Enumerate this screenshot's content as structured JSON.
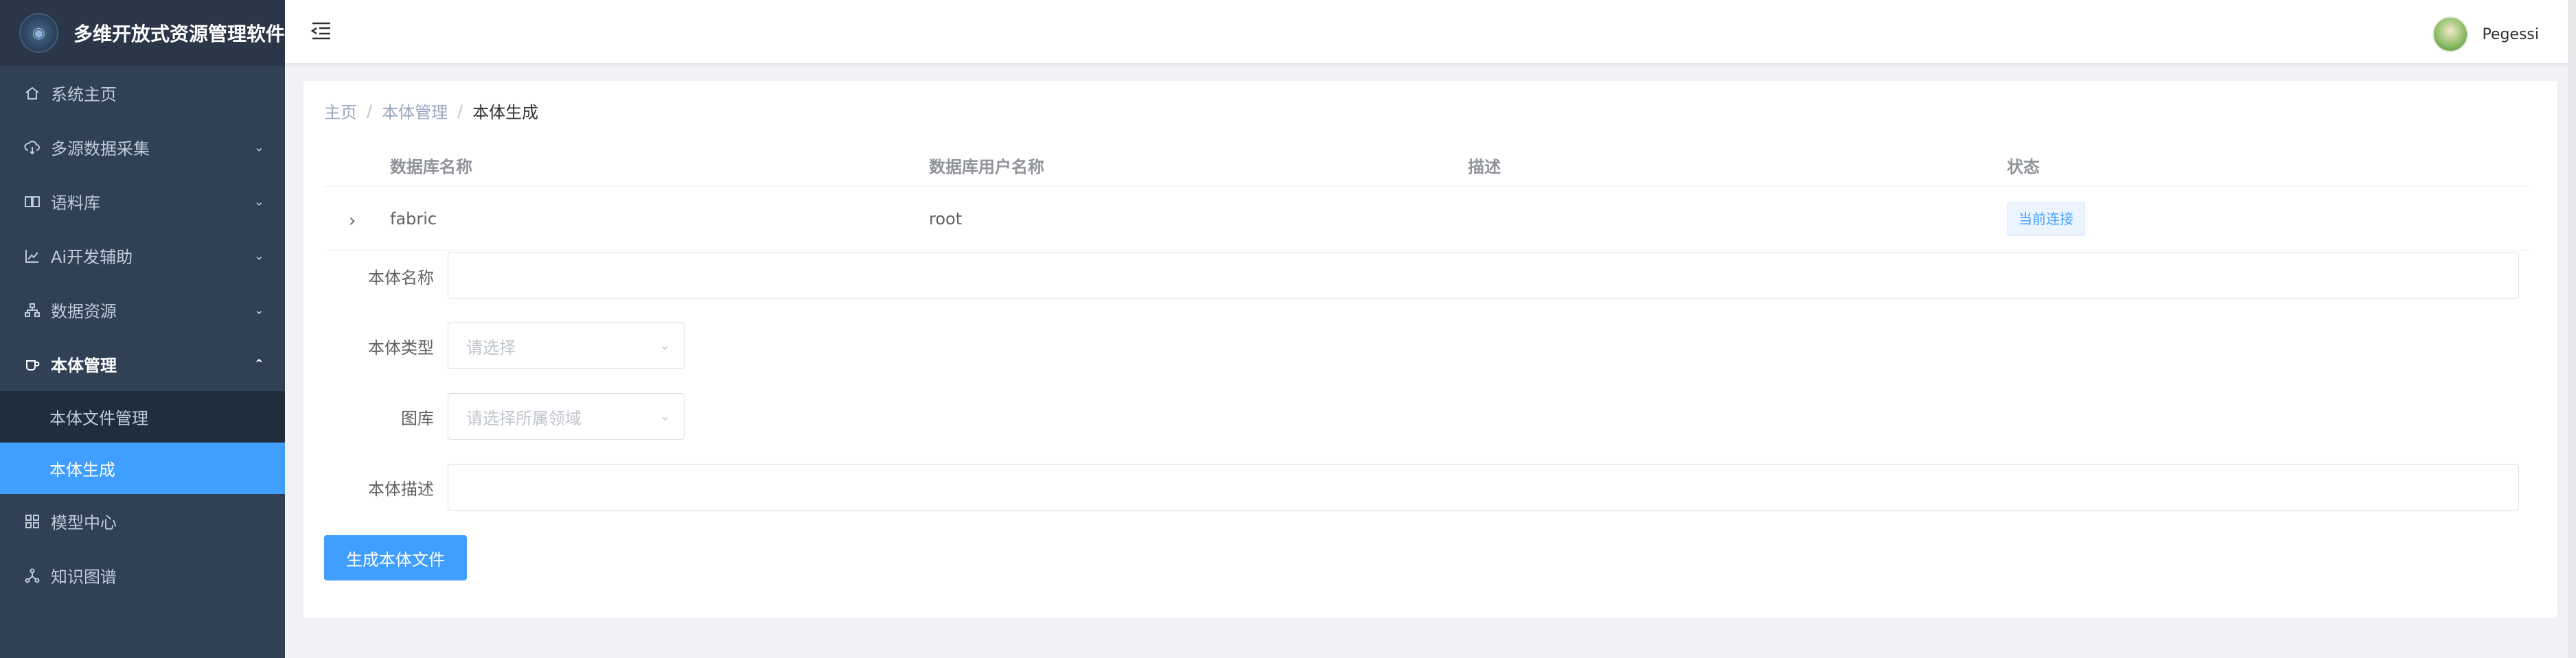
{
  "app": {
    "title": "多维开放式资源管理软件"
  },
  "sidebar": {
    "items": [
      {
        "label": "系统主页",
        "icon": "home-icon"
      },
      {
        "label": "多源数据采集",
        "icon": "cloud-download-icon"
      },
      {
        "label": "语料库",
        "icon": "book-icon"
      },
      {
        "label": "Ai开发辅助",
        "icon": "chart-line-icon"
      },
      {
        "label": "数据资源",
        "icon": "sitemap-icon"
      },
      {
        "label": "本体管理",
        "icon": "cup-icon"
      },
      {
        "label": "模型中心",
        "icon": "grid-icon"
      },
      {
        "label": "知识图谱",
        "icon": "share-icon"
      }
    ],
    "submenu": [
      {
        "label": "本体文件管理"
      },
      {
        "label": "本体生成"
      }
    ]
  },
  "navbar": {
    "username": "Pegessi"
  },
  "breadcrumb": {
    "items": [
      "主页",
      "本体管理",
      "本体生成"
    ],
    "separator": "/"
  },
  "table": {
    "headers": [
      "数据库名称",
      "数据库用户名称",
      "描述",
      "状态"
    ],
    "rows": [
      {
        "name": "fabric",
        "user": "root",
        "desc": "",
        "status": "当前连接"
      }
    ]
  },
  "form": {
    "name_label": "本体名称",
    "type_label": "本体类型",
    "type_placeholder": "请选择",
    "graph_label": "图库",
    "graph_placeholder": "请选择所属领域",
    "desc_label": "本体描述",
    "submit_label": "生成本体文件"
  },
  "colors": {
    "sidebar_bg": "#304156",
    "accent": "#409eff"
  }
}
